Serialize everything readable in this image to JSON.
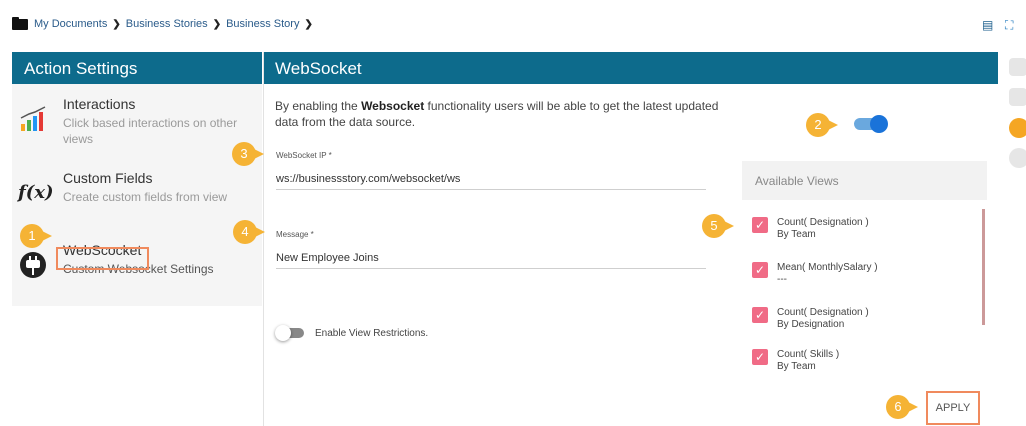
{
  "breadcrumb": {
    "items": [
      "My Documents",
      "Business Stories",
      "Business Story"
    ]
  },
  "left_panel": {
    "title": "Action Settings",
    "items": [
      {
        "title": "Interactions",
        "desc": "Click based interactions on other views"
      },
      {
        "title": "Custom Fields",
        "desc": "Create custom fields from view"
      },
      {
        "title": "WebScocket",
        "desc": "Custom Websocket Settings"
      }
    ]
  },
  "main": {
    "title": "WebSocket",
    "description_pre": "By enabling the ",
    "description_bold": "Websocket",
    "description_post": " functionality users will be able to get the latest updated data from the data source.",
    "websocket_enabled": true,
    "ip_label": "WebSocket IP *",
    "ip_value": "ws://businessstory.com/websocket/ws",
    "message_label": "Message *",
    "message_value": "New Employee Joins",
    "restriction_label": "Enable View Restrictions.",
    "restriction_enabled": false,
    "apply_label": "APPLY"
  },
  "views": {
    "header": "Available Views",
    "items": [
      {
        "name": "Count( Designation )",
        "sub": "By Team",
        "checked": true
      },
      {
        "name": "Mean( MonthlySalary )",
        "sub": "---",
        "checked": true
      },
      {
        "name": "Count( Designation )",
        "sub": "By Designation",
        "checked": true
      },
      {
        "name": "Count( Skills )",
        "sub": "By Team",
        "checked": true
      }
    ]
  },
  "callouts": [
    "1",
    "2",
    "3",
    "4",
    "5",
    "6"
  ],
  "colors": {
    "header": "#0d6b8c",
    "accent": "#f5b335",
    "highlight": "#f08a5d",
    "checkbox": "#f06b86",
    "toggle": "#1a73d9"
  }
}
